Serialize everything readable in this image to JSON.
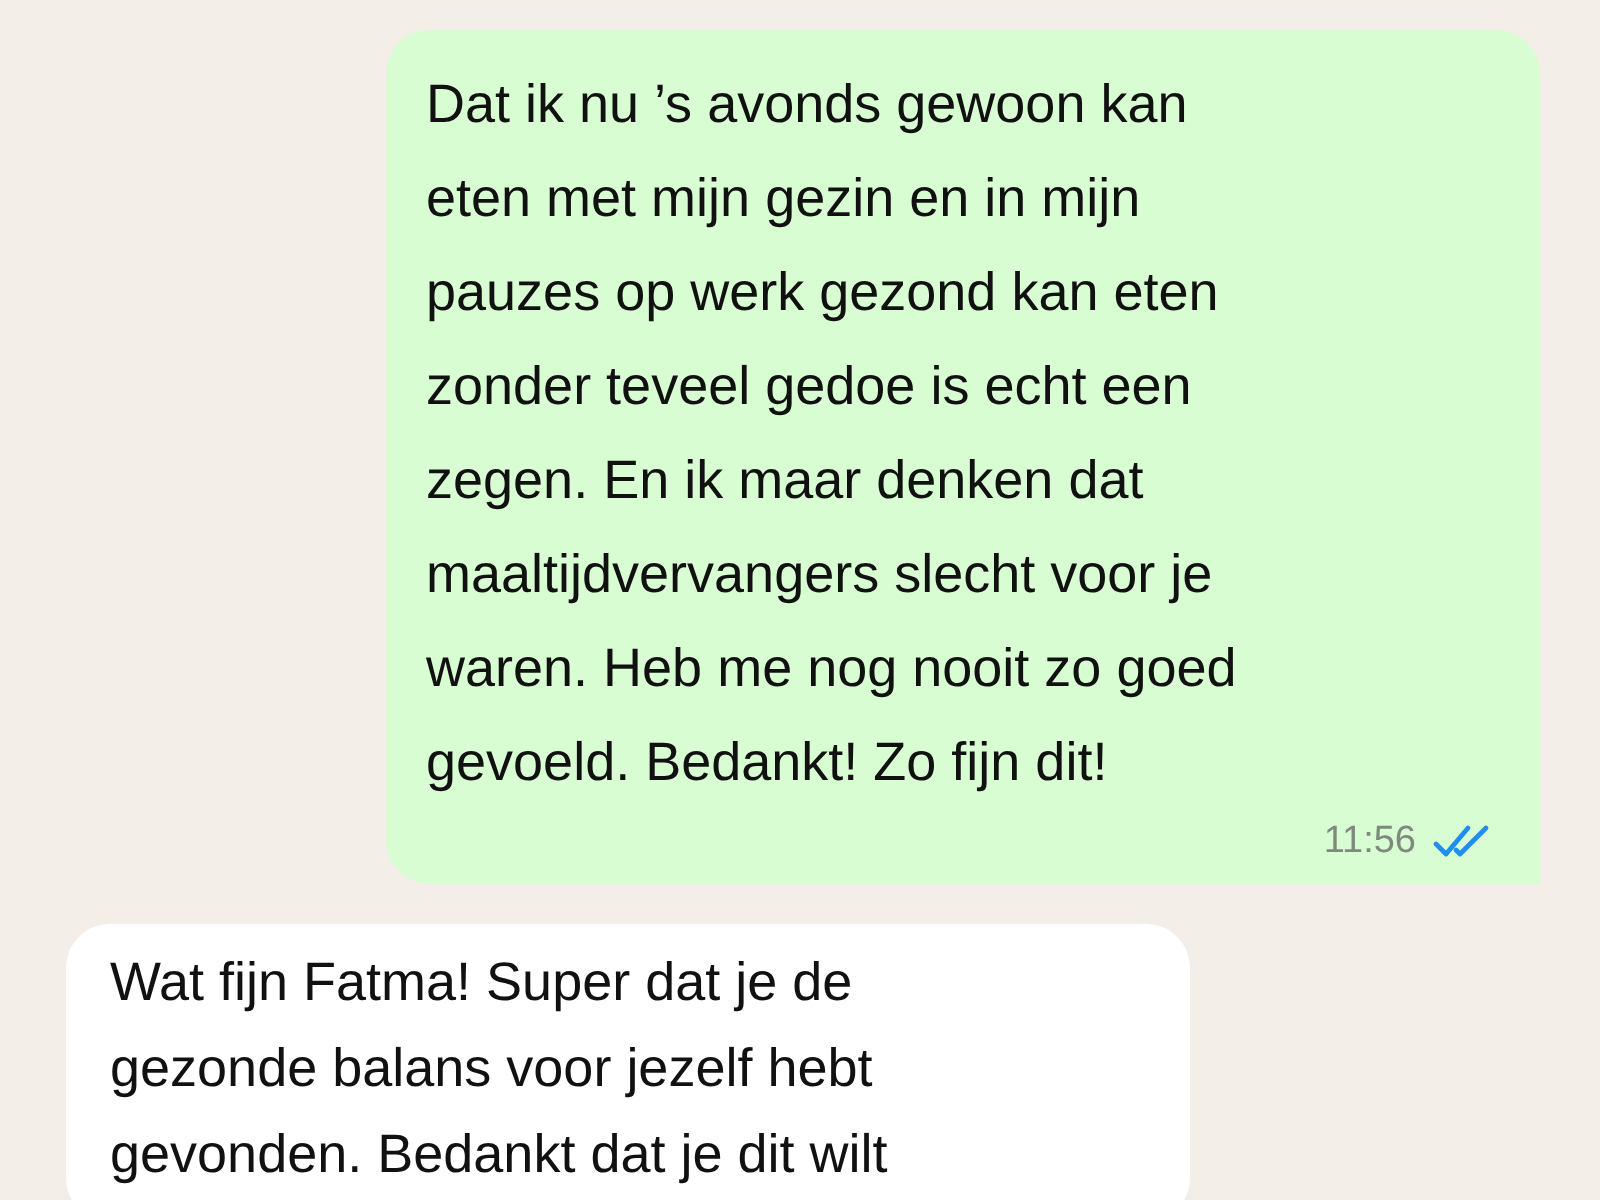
{
  "messages": [
    {
      "kind": "outgoing",
      "text": "Dat ik nu ’s avonds gewoon kan\neten met mijn gezin en in mijn\npauzes op werk gezond kan eten\nzonder teveel gedoe is echt een\nzegen. En ik maar denken dat\nmaaltijdvervangers slecht voor je\nwaren. Heb me nog nooit zo goed\ngevoeld. Bedankt! Zo fijn dit!",
      "time": "11:56",
      "read": true
    },
    {
      "kind": "incoming",
      "text": "Wat fijn Fatma! Super dat je de\ngezonde balans voor jezelf hebt\ngevonden. Bedankt dat je dit wilt"
    }
  ]
}
